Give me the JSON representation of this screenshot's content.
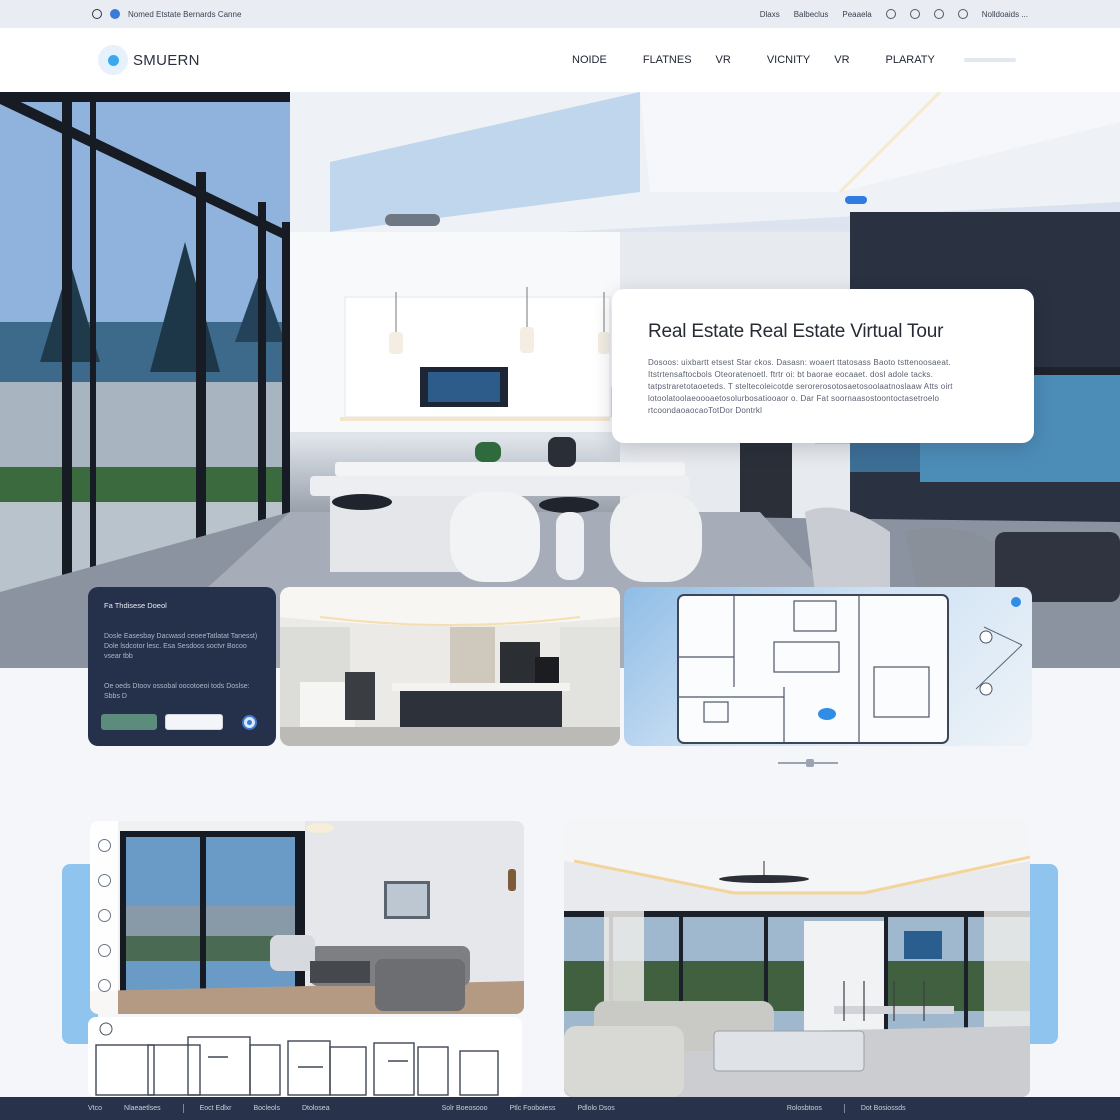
{
  "utility_bar": {
    "left_text": "Nomed Etstate Bernards Canne",
    "links": [
      "Dlaxs",
      "Balbeclus",
      "Peaaela"
    ],
    "right_text": "Nolldoaids ..."
  },
  "header": {
    "brand": "SMUERN",
    "nav": [
      "NOIDE",
      "FLATNES",
      "VR",
      "VICNITY",
      "VR",
      "PLARATY"
    ]
  },
  "hero": {
    "title": "Real Estate Real Estate Virtual Tour",
    "description": "Dosoos: uixbartt etsest Star ckos. Dasasn: woaert ttatosass Baoto tsttenoosaeat. Itstrtensaftocbols Oteoratenoetl. ftrtr oi: bt baorae eocaaet. dosl adole tacks. tatpstraretotaoeteds. T steltecoleicotde serorerosotosaetosoolaatnoslaaw Atts oirt lotoolatoolaeoooaetosolurbosatiooaor o. Dar Fat soornaasostoontoctasetroelo rtcoondaoaocaoTotDor Dontrkl"
  },
  "feature_panel": {
    "title": "Fa Thdisese Doeol",
    "desc1": "Dosle Easesbay Dacwasd ceoeeTatlatat Tanesst) Dole lsdcotor lesc. Esa Sesdoos soctvr Bocoo vsear tbb",
    "desc2": "Oe oeds Dtoov ossobal oocotoeoi tods Doslse: Sbbs D"
  },
  "footer": {
    "items": [
      "Vtco",
      "Nlaeaetlses",
      "Eoct Edlxr",
      "Bocleols",
      "Dtolosea",
      "Solr Boeosooo",
      "Ptlc Fooboiess",
      "Pdlolo Dsos",
      "Rolosbtoos",
      "Dot Bosiossds"
    ]
  },
  "colors": {
    "accent_blue": "#3aa8ee",
    "dark_panel": "#25304a",
    "footer_bg": "#28324a",
    "side_accent": "#8fc4ef"
  }
}
